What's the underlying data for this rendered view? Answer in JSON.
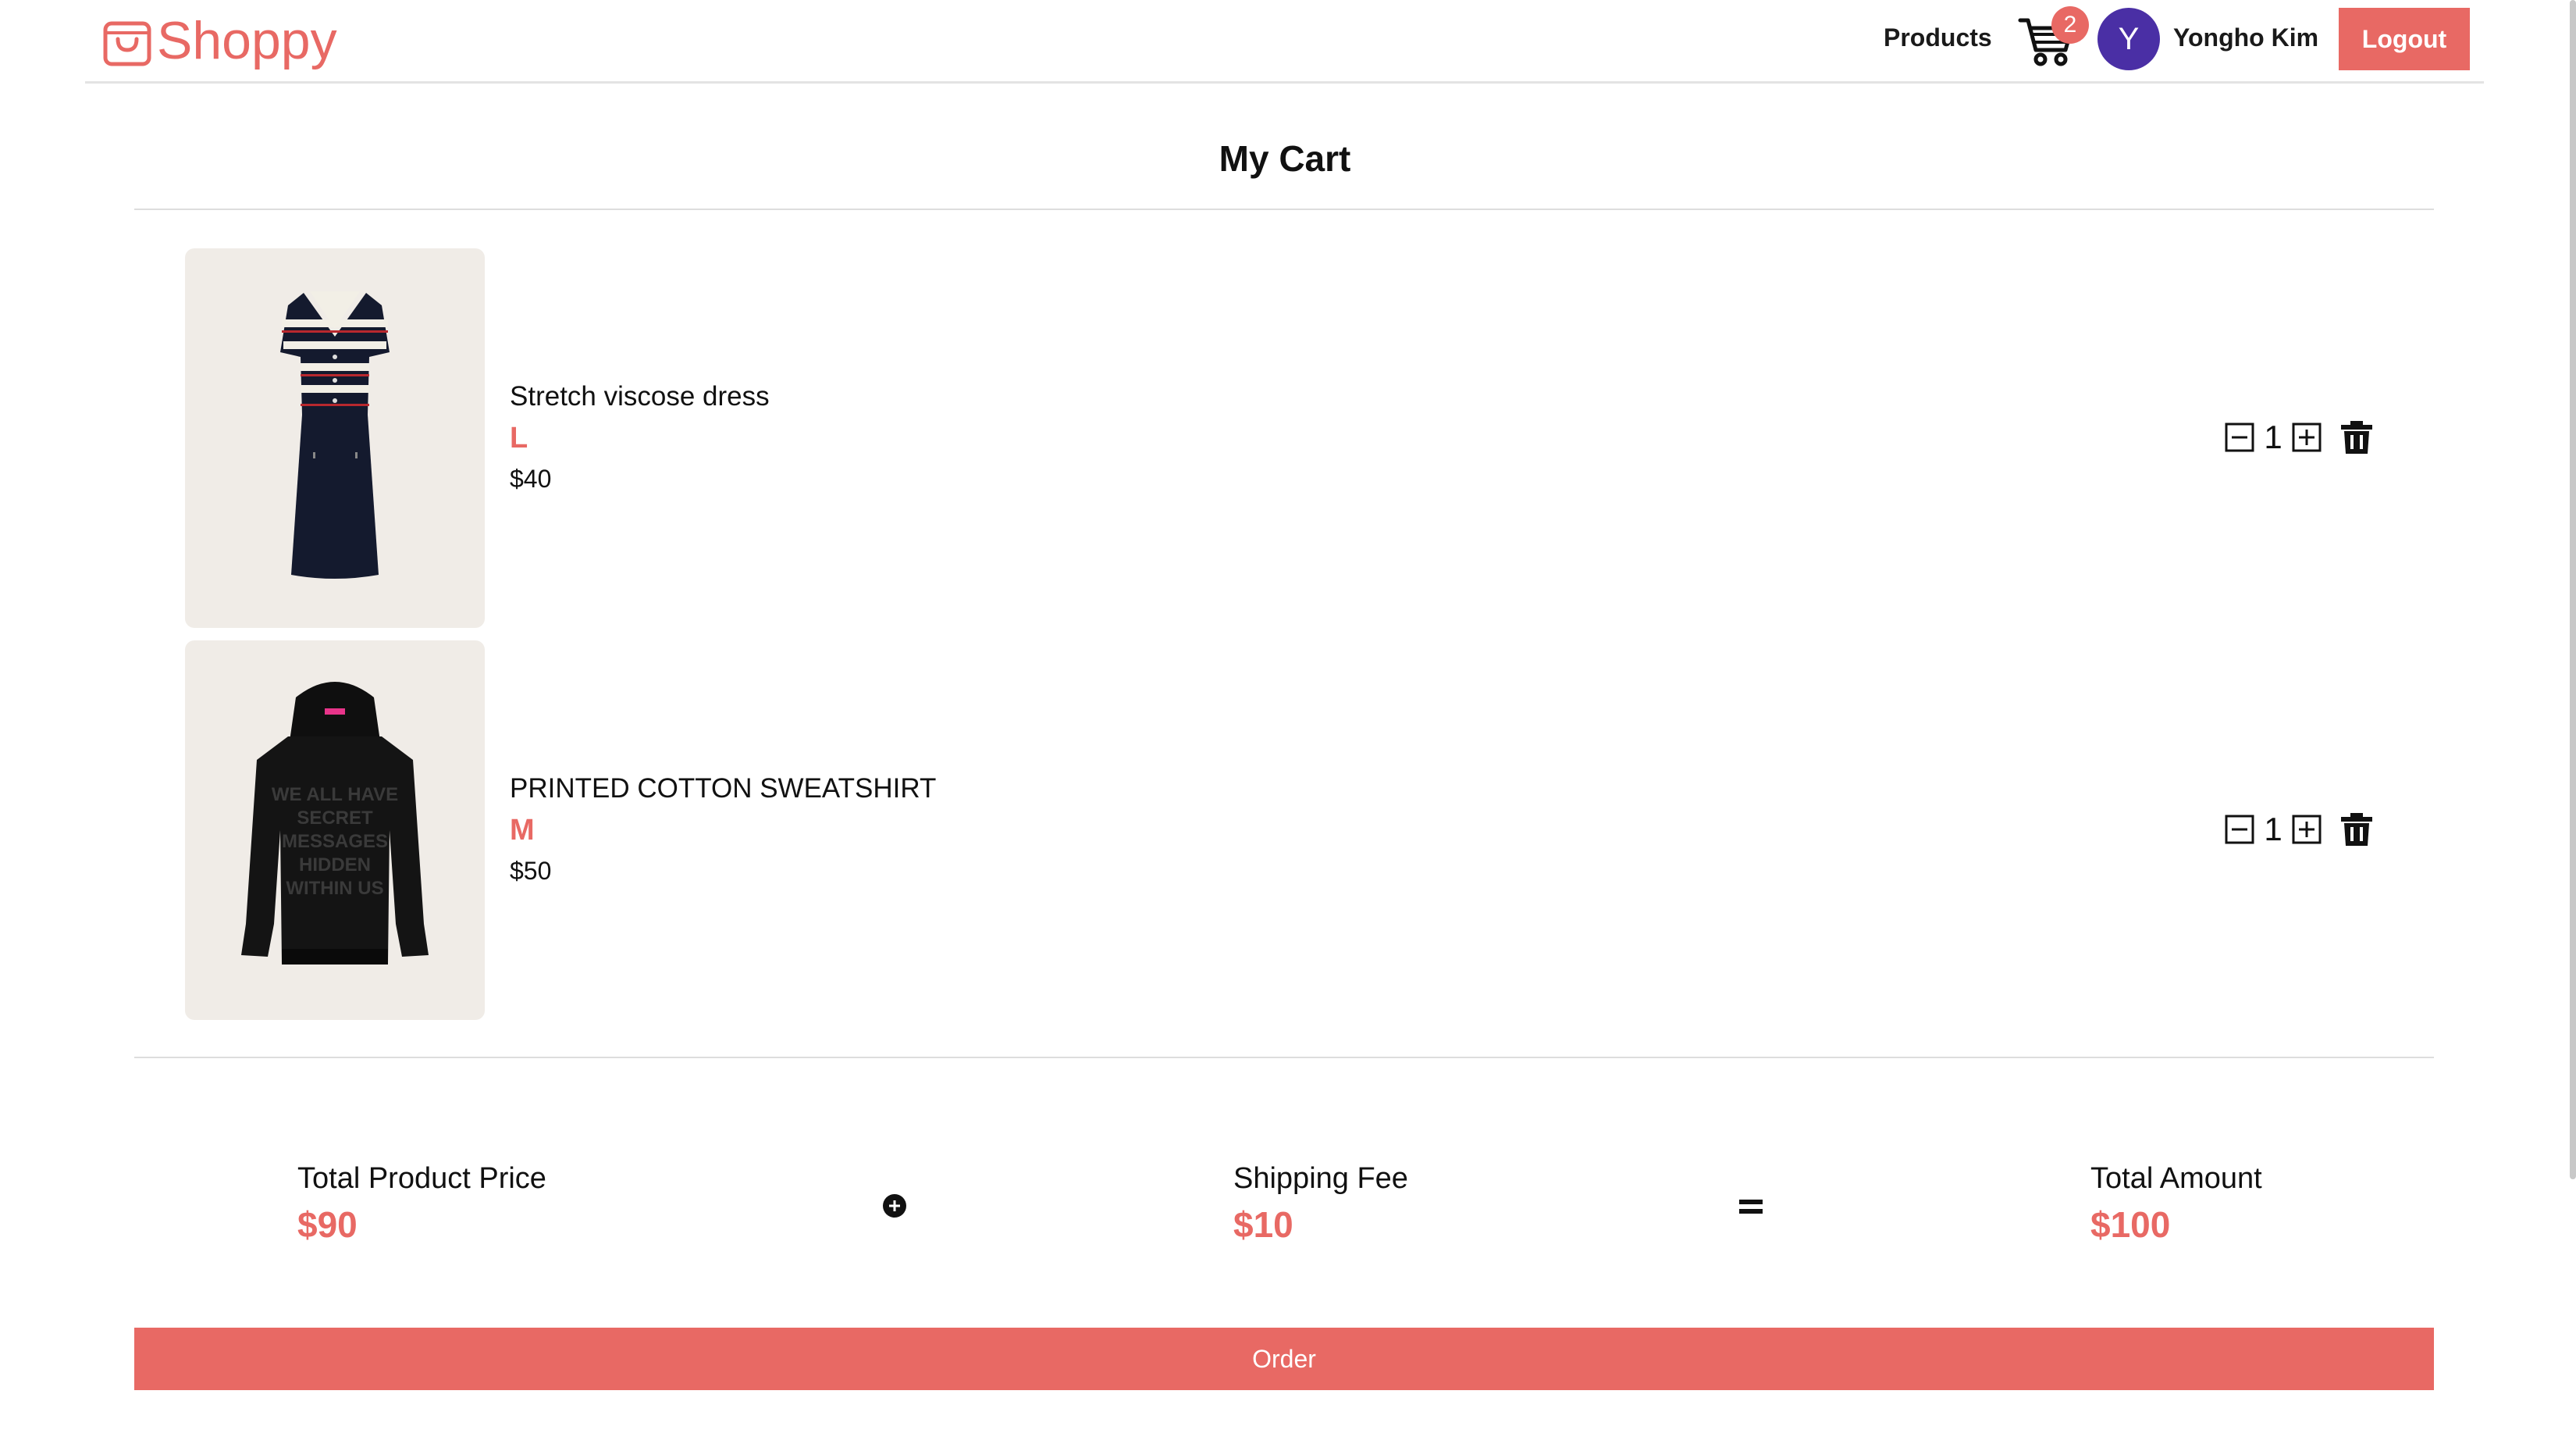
{
  "header": {
    "logo_text": "Shoppy",
    "nav_products": "Products",
    "cart_count": "2",
    "avatar_initial": "Y",
    "user_name": "Yongho Kim",
    "logout_label": "Logout"
  },
  "page_title": "My Cart",
  "cart_items": [
    {
      "name": "Stretch viscose dress",
      "size": "L",
      "price": "$40",
      "quantity": "1",
      "image": "striped-knit-dress"
    },
    {
      "name": "PRINTED COTTON SWEATSHIRT",
      "size": "M",
      "price": "$50",
      "quantity": "1",
      "image": "black-printed-hoodie",
      "print_text": [
        "WE ALL HAVE",
        "SECRET",
        "MESSAGES",
        "HIDDEN",
        "WITHIN US"
      ]
    }
  ],
  "summary": {
    "product_price_label": "Total Product Price",
    "product_price_value": "$90",
    "shipping_label": "Shipping Fee",
    "shipping_value": "$10",
    "total_label": "Total Amount",
    "total_value": "$100"
  },
  "order_label": "Order",
  "colors": {
    "accent": "#e86964",
    "avatar": "#4a2fa5",
    "image_bg": "#f0ece7"
  }
}
